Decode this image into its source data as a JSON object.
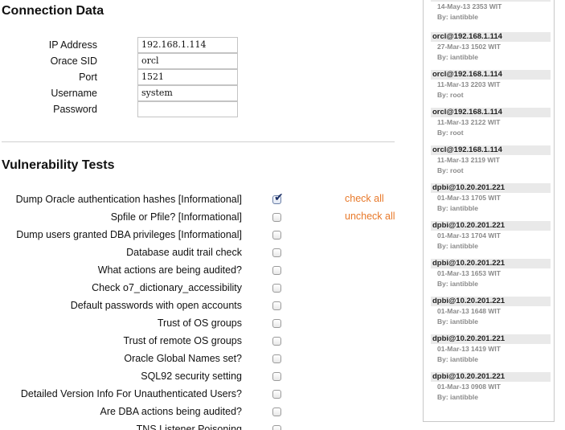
{
  "connection": {
    "title": "Connection Data",
    "fields": [
      {
        "label": "IP Address",
        "value": "192.168.1.114"
      },
      {
        "label": "Orace SID",
        "value": "orcl"
      },
      {
        "label": "Port",
        "value": "1521"
      },
      {
        "label": "Username",
        "value": "system"
      },
      {
        "label": "Password",
        "value": ""
      }
    ]
  },
  "tests": {
    "title": "Vulnerability Tests",
    "check_all_label": "check all",
    "uncheck_all_label": "uncheck all",
    "items": [
      {
        "label": "Dump Oracle authentication hashes [Informational]",
        "checked": true
      },
      {
        "label": "Spfile or Pfile? [Informational]",
        "checked": false
      },
      {
        "label": "Dump users granted DBA privileges [Informational]",
        "checked": false
      },
      {
        "label": "Database audit trail check",
        "checked": false
      },
      {
        "label": "What actions are being audited?",
        "checked": false
      },
      {
        "label": "Check o7_dictionary_accessibility",
        "checked": false
      },
      {
        "label": "Default passwords with open accounts",
        "checked": false
      },
      {
        "label": "Trust of OS groups",
        "checked": false
      },
      {
        "label": "Trust of remote OS groups",
        "checked": false
      },
      {
        "label": "Oracle Global Names set?",
        "checked": false
      },
      {
        "label": "SQL92 security setting",
        "checked": false
      },
      {
        "label": "Detailed Version Info For Unauthenticated Users?",
        "checked": false
      },
      {
        "label": "Are DBA actions being audited?",
        "checked": false
      },
      {
        "label": "TNS Listener Poisoning",
        "checked": false
      }
    ]
  },
  "history": {
    "entries": [
      {
        "target": "",
        "date": "14-May-13 2353 WIT",
        "by": "By: iantibble"
      },
      {
        "target": "orcl@192.168.1.114",
        "date": "27-Mar-13 1502 WIT",
        "by": "By: iantibble"
      },
      {
        "target": "orcl@192.168.1.114",
        "date": "11-Mar-13 2203 WIT",
        "by": "By: root"
      },
      {
        "target": "orcl@192.168.1.114",
        "date": "11-Mar-13 2122 WIT",
        "by": "By: root"
      },
      {
        "target": "orcl@192.168.1.114",
        "date": "11-Mar-13 2119 WIT",
        "by": "By: root"
      },
      {
        "target": "dpbi@10.20.201.221",
        "date": "01-Mar-13 1705 WIT",
        "by": "By: iantibble"
      },
      {
        "target": "dpbi@10.20.201.221",
        "date": "01-Mar-13 1704 WIT",
        "by": "By: iantibble"
      },
      {
        "target": "dpbi@10.20.201.221",
        "date": "01-Mar-13 1653 WIT",
        "by": "By: iantibble"
      },
      {
        "target": "dpbi@10.20.201.221",
        "date": "01-Mar-13 1648 WIT",
        "by": "By: iantibble"
      },
      {
        "target": "dpbi@10.20.201.221",
        "date": "01-Mar-13 1419 WIT",
        "by": "By: iantibble"
      },
      {
        "target": "dpbi@10.20.201.221",
        "date": "01-Mar-13 0908 WIT",
        "by": "By: iantibble"
      }
    ]
  }
}
